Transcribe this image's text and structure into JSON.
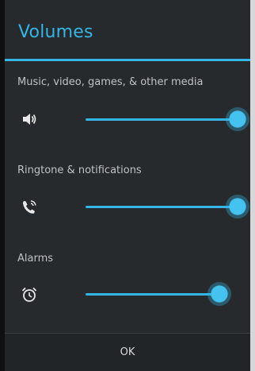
{
  "dialog": {
    "title": "Volumes",
    "ok_label": "OK"
  },
  "colors": {
    "accent": "#33b5e5",
    "background": "#272a2d"
  },
  "sections": [
    {
      "label": "Music, video, games, & other media",
      "icon": "speaker-volume-icon",
      "level": 0.94
    },
    {
      "label": "Ringtone & notifications",
      "icon": "ringer-phone-icon",
      "level": 0.94
    },
    {
      "label": "Alarms",
      "icon": "alarm-clock-icon",
      "level": 0.83
    }
  ]
}
